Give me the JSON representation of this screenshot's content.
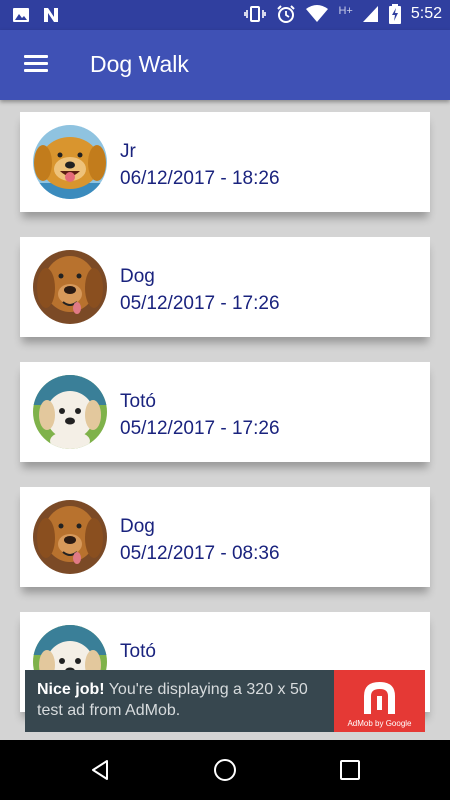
{
  "status_bar": {
    "time": "5:52",
    "network_type": "H+",
    "icons": [
      "image-icon",
      "n-notification-icon",
      "vibrate-icon",
      "alarm-icon",
      "wifi-icon",
      "signal-icon",
      "battery-charging-icon"
    ]
  },
  "app_bar": {
    "title": "Dog Walk",
    "menu_icon": "hamburger-icon",
    "color": "#3f51b5"
  },
  "walks": [
    {
      "name": "Jr",
      "datetime": "06/12/2017 - 18:26",
      "avatar": "golden-retriever"
    },
    {
      "name": "Dog",
      "datetime": "05/12/2017 - 17:26",
      "avatar": "labrador"
    },
    {
      "name": "Totó",
      "datetime": "05/12/2017 - 17:26",
      "avatar": "white-puppy"
    },
    {
      "name": "Dog",
      "datetime": "05/12/2017 - 08:36",
      "avatar": "labrador"
    },
    {
      "name": "Totó",
      "datetime": "",
      "avatar": "white-puppy"
    }
  ],
  "ad": {
    "headline": "Nice job!",
    "body": " You're displaying a 320 x 50 test ad from AdMob.",
    "brand": "AdMob by Google",
    "brand_color": "#e53935",
    "background": "#37474f"
  },
  "nav_bar": {
    "buttons": [
      "back-icon",
      "home-icon",
      "recents-icon"
    ]
  }
}
